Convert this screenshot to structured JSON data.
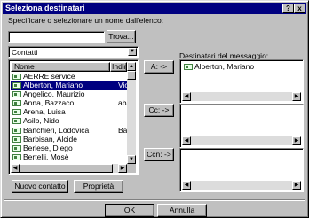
{
  "window": {
    "title": "Seleziona destinatari",
    "help_button": "?",
    "close_button": "x"
  },
  "search": {
    "prompt": "Specificare o selezionare un nome dall'elenco:",
    "value": "",
    "find_button": "Trova..."
  },
  "address_book": {
    "selected": "Contatti",
    "dropdown_arrow": "▼"
  },
  "list": {
    "columns": [
      "Nome",
      "Indiri"
    ],
    "rows": [
      {
        "name": "AERRE service",
        "address": ""
      },
      {
        "name": "Alberton, Mariano",
        "address": "Vicar",
        "selected": true
      },
      {
        "name": "Angelico, Maurizio",
        "address": ""
      },
      {
        "name": "Anna, Bazzaco",
        "address": "abaz"
      },
      {
        "name": "Arena, Luisa",
        "address": ""
      },
      {
        "name": "Asilo, Nido",
        "address": ""
      },
      {
        "name": "Banchieri, Lodovica",
        "address": "Bass"
      },
      {
        "name": "Barbisan, Alcide",
        "address": ""
      },
      {
        "name": "Berlese, Diego",
        "address": ""
      },
      {
        "name": "Bertelli, Mosè",
        "address": ""
      }
    ]
  },
  "buttons": {
    "new_contact": "Nuovo contatto",
    "properties": "Proprietà",
    "to": "A: ->",
    "cc": "Cc: ->",
    "bcc": "Ccn: ->",
    "ok": "OK",
    "cancel": "Annulla"
  },
  "recipients": {
    "label": "Destinatari del messaggio:",
    "to": [
      "Alberton, Mariano"
    ],
    "cc": [],
    "bcc": []
  },
  "colors": {
    "titlebar": "#000080",
    "face": "#c0c0c0",
    "selection": "#000080"
  }
}
